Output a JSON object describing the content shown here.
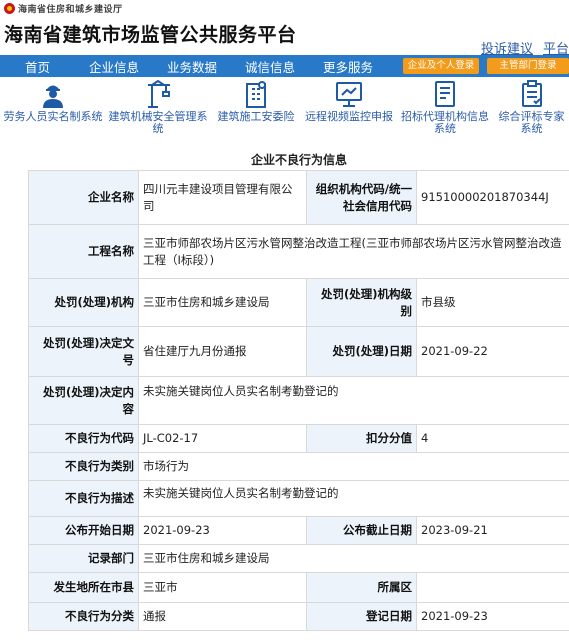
{
  "header": {
    "dept_name": "海南省住房和城乡建设厅",
    "title": "海南省建筑市场监管公共服务平台",
    "links": [
      "投诉建议",
      "平台"
    ]
  },
  "nav": {
    "items": [
      "首页",
      "企业信息",
      "业务数据",
      "诚信信息",
      "更多服务"
    ],
    "login_personal": "企业及个人登录",
    "login_dept": "主管部门登录"
  },
  "icon_bar": {
    "items": [
      {
        "label": "劳务人员实名制系统",
        "icon": "worker-icon"
      },
      {
        "label": "建筑机械安全管理系统",
        "icon": "crane-icon"
      },
      {
        "label": "建筑施工安委险",
        "icon": "building-icon"
      },
      {
        "label": "远程视频监控申报",
        "icon": "monitor-icon"
      },
      {
        "label": "招标代理机构信息系统",
        "icon": "document-icon"
      },
      {
        "label": "综合评标专家系统",
        "icon": "clipboard-icon"
      }
    ]
  },
  "record": {
    "caption": "企业不良行为信息",
    "company_name_label": "企业名称",
    "company_name": "四川元丰建设项目管理有限公司",
    "org_code_label": "组织机构代码/统一社会信用代码",
    "org_code": "91510000201870344J",
    "project_label": "工程名称",
    "project": "三亚市师部农场片区污水管网整治改造工程(三亚市师部农场片区污水管网整治改造工程（Ⅰ标段）)",
    "agency_label": "处罚(处理)机构",
    "agency": "三亚市住房和城乡建设局",
    "agency_level_label": "处罚(处理)机构级别",
    "agency_level": "市县级",
    "decision_no_label": "处罚(处理)决定文号",
    "decision_no": "省住建厅九月份通报",
    "decision_date_label": "处罚(处理)日期",
    "decision_date": "2021-09-22",
    "decision_content_label": "处罚(处理)决定内容",
    "decision_content": "未实施关键岗位人员实名制考勤登记的",
    "behavior_code_label": "不良行为代码",
    "behavior_code": "JL-C02-17",
    "deduct_label": "扣分分值",
    "deduct": "4",
    "behavior_type_label": "不良行为类别",
    "behavior_type": "市场行为",
    "behavior_desc_label": "不良行为描述",
    "behavior_desc": "未实施关键岗位人员实名制考勤登记的",
    "pub_start_label": "公布开始日期",
    "pub_start": "2021-09-23",
    "pub_end_label": "公布截止日期",
    "pub_end": "2023-09-21",
    "record_dept_label": "记录部门",
    "record_dept": "三亚市住房和城乡建设局",
    "city_label": "发生地所在市县",
    "city": "三亚市",
    "district_label": "所属区",
    "district": "",
    "category_label": "不良行为分类",
    "category": "通报",
    "reg_date_label": "登记日期",
    "reg_date": "2021-09-23"
  }
}
